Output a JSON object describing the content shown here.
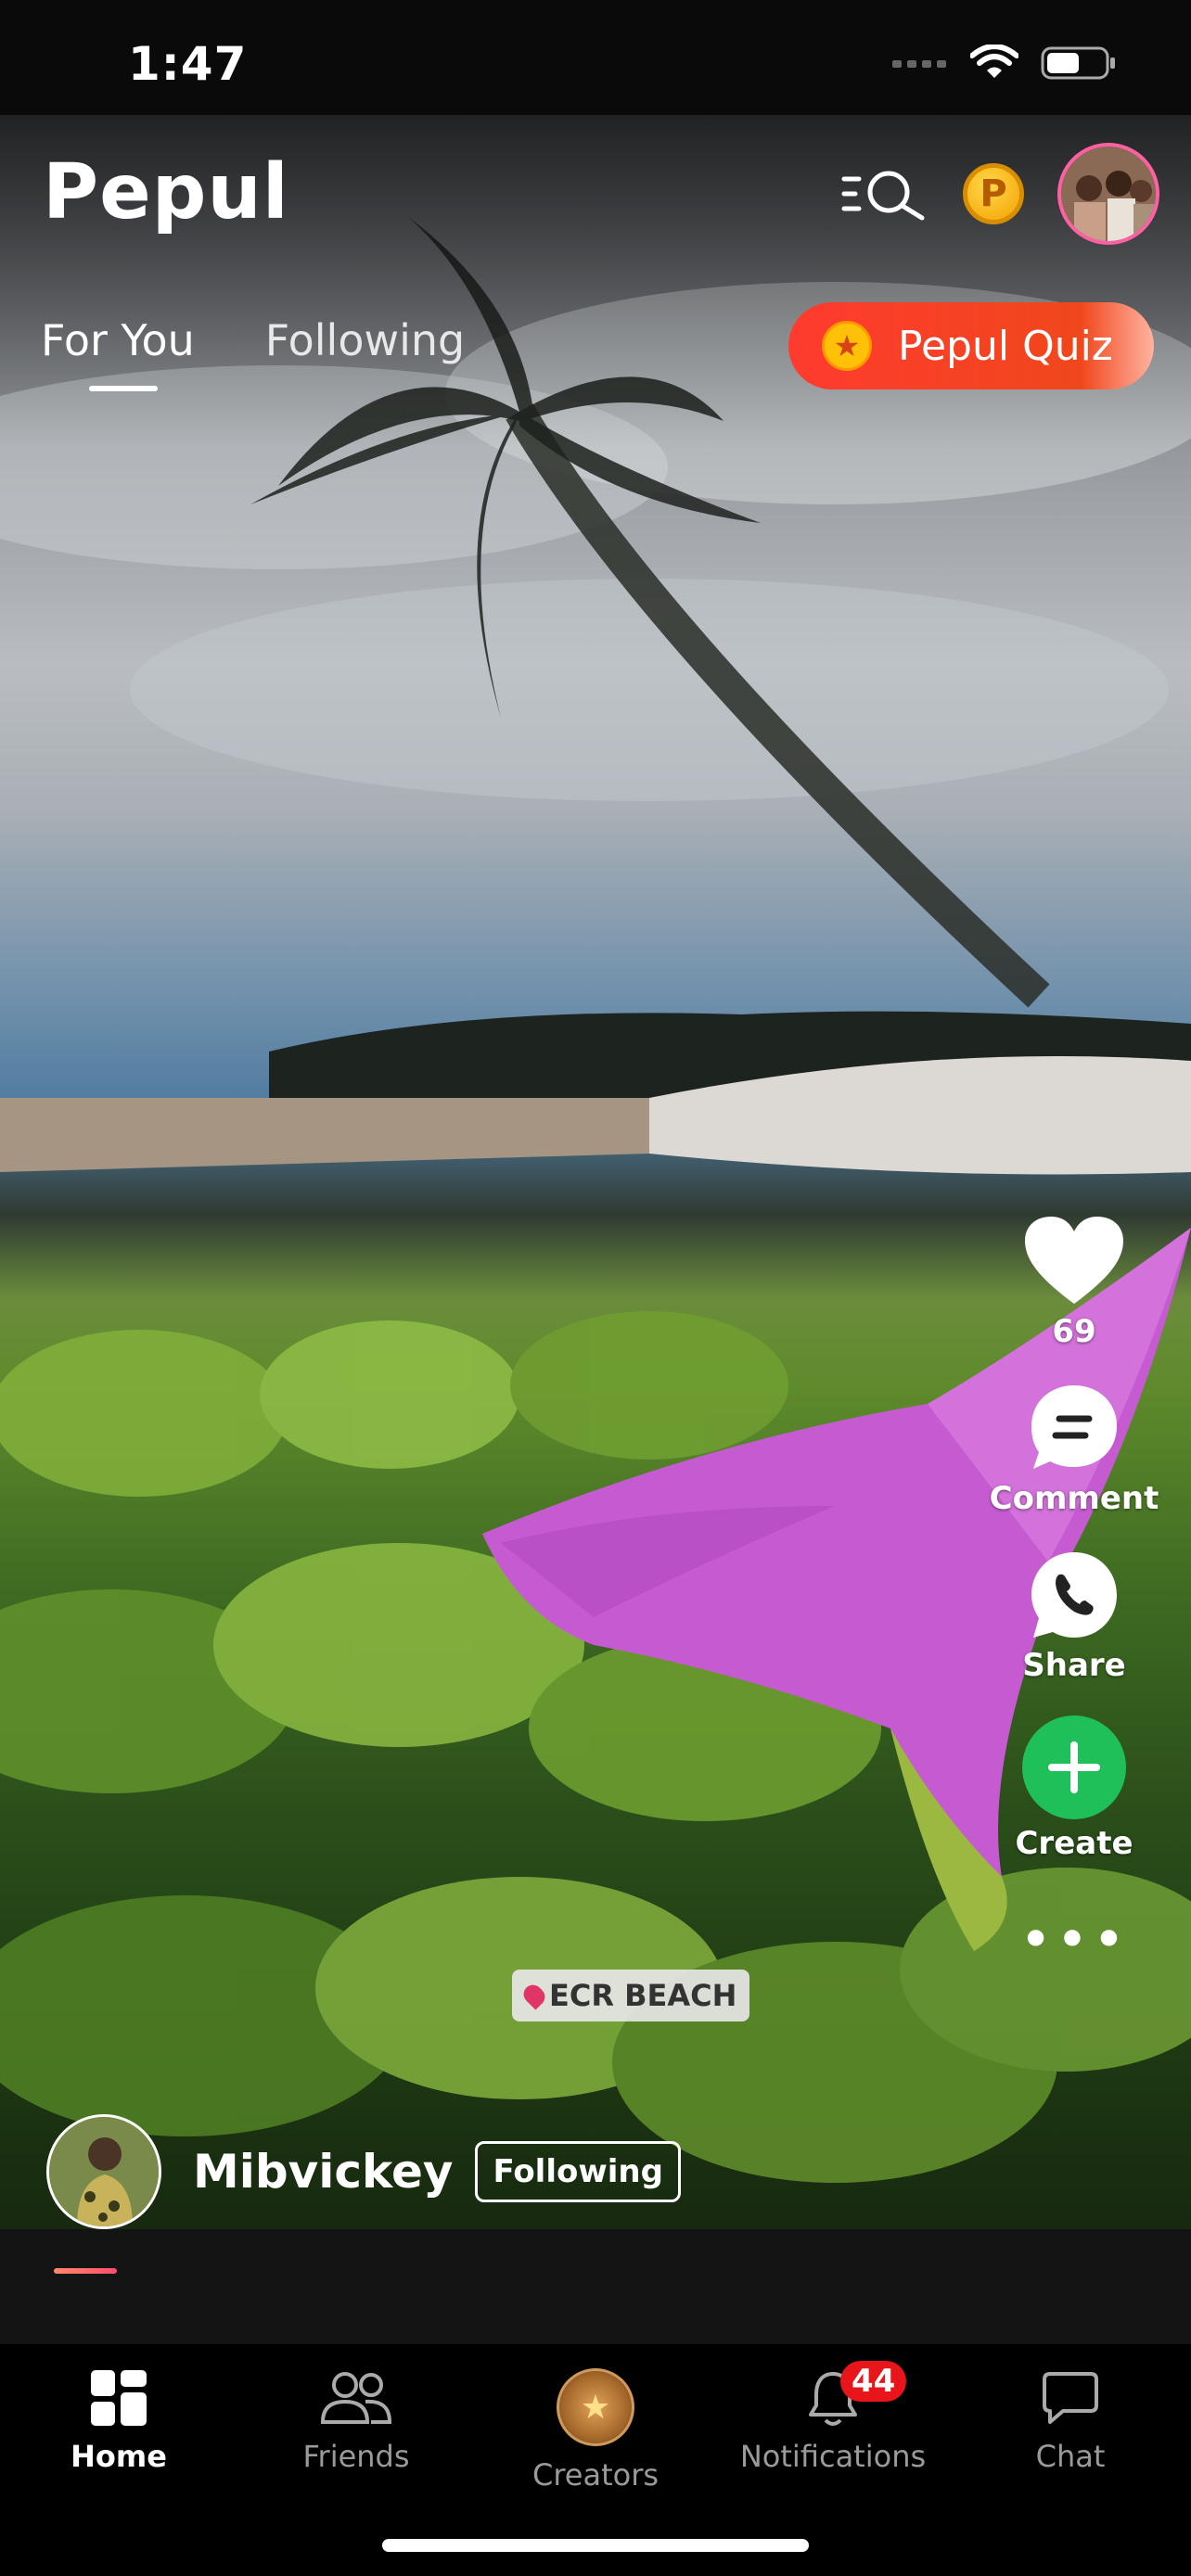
{
  "status_bar": {
    "time": "1:47"
  },
  "header": {
    "brand": "Pepul",
    "coin_letter": "P"
  },
  "tabs": [
    {
      "label": "For You"
    },
    {
      "label": "Following"
    }
  ],
  "quiz": {
    "label": "Pepul Quiz"
  },
  "actions": {
    "like_count": "69",
    "comment_label": "Comment",
    "share_label": "Share",
    "create_label": "Create"
  },
  "post": {
    "location_tag": "ECR BEACH",
    "author_name": "Mibvickey",
    "follow_state": "Following",
    "progress": 0.05
  },
  "bottom_nav": {
    "items": [
      {
        "label": "Home"
      },
      {
        "label": "Friends"
      },
      {
        "label": "Creators"
      },
      {
        "label": "Notifications",
        "badge": "44"
      },
      {
        "label": "Chat"
      }
    ]
  },
  "colors": {
    "accent_red": "#f0471c",
    "create_green": "#1fbf5a",
    "badge_red": "#e8151b"
  }
}
